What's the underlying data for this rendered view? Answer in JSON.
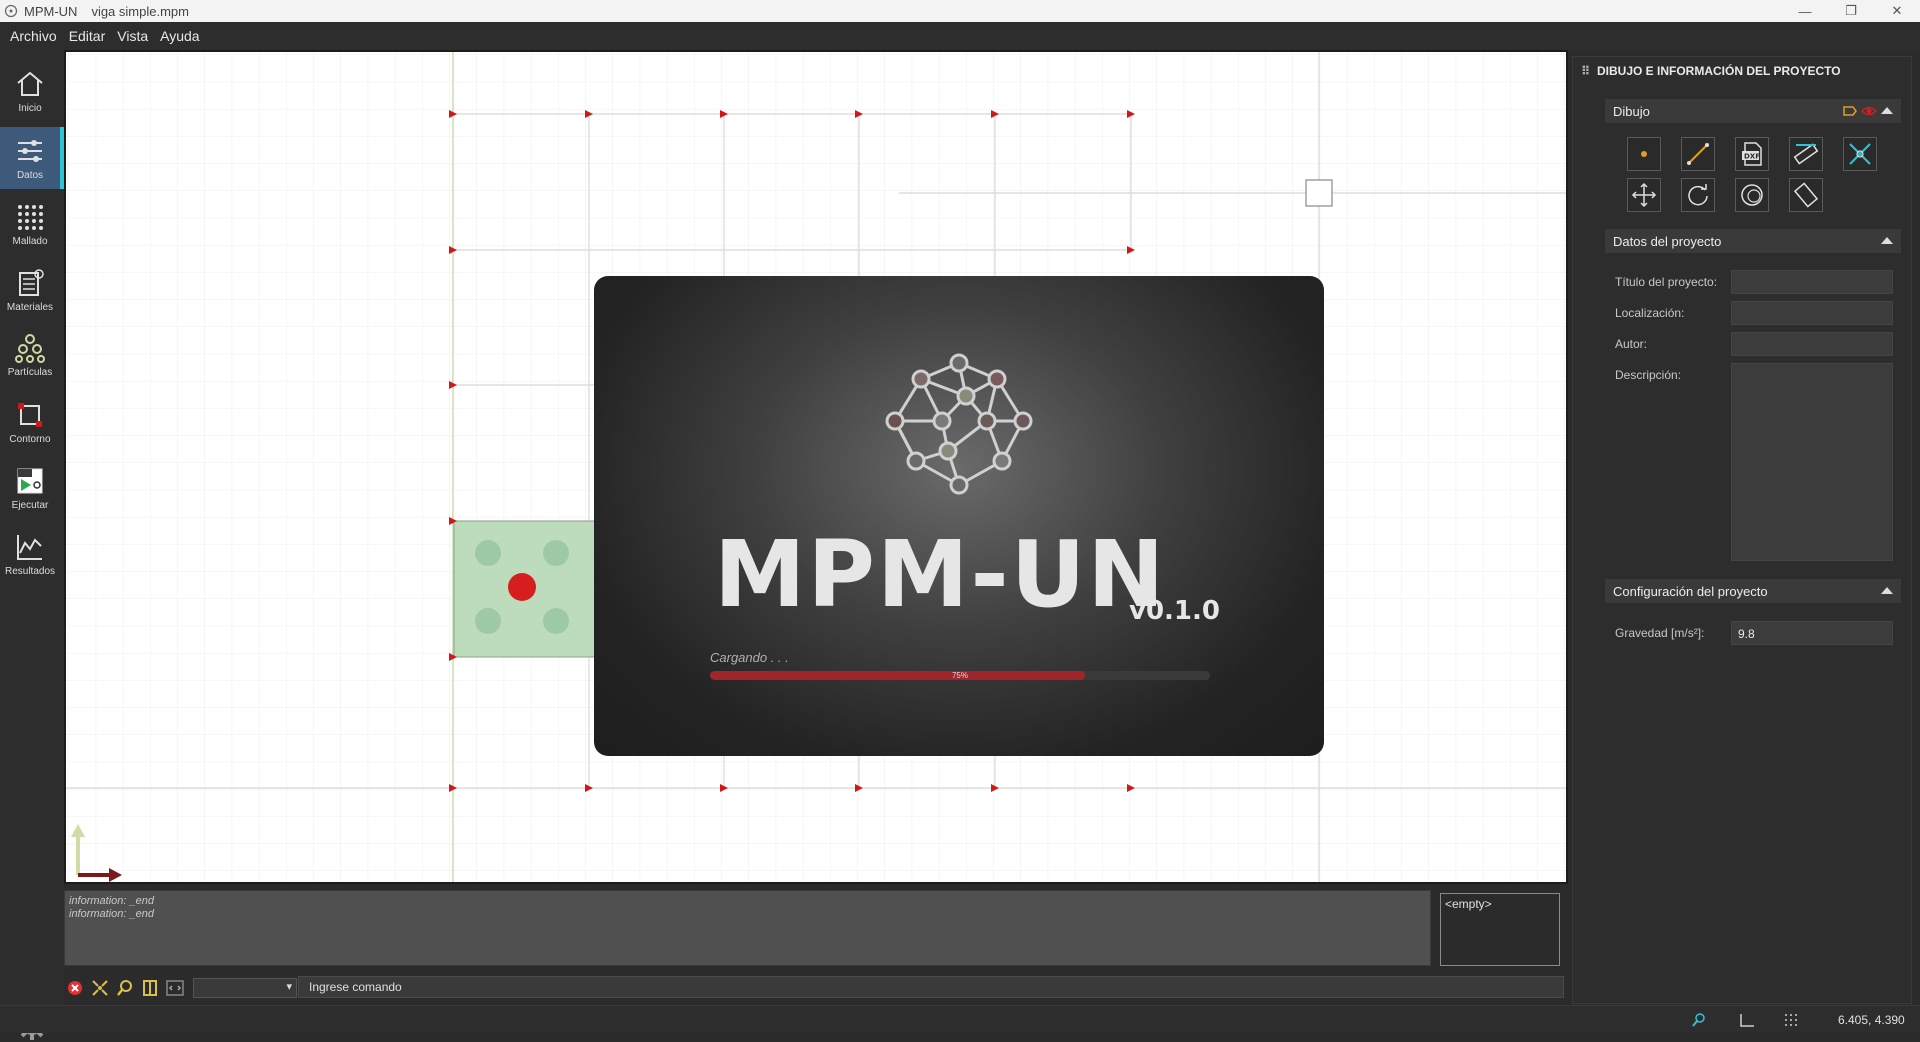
{
  "window": {
    "app_name": "MPM-UN",
    "document": "viga simple.mpm",
    "controls": [
      "—",
      "❐",
      "✕"
    ]
  },
  "menu": [
    "Archivo",
    "Editar",
    "Vista",
    "Ayuda"
  ],
  "left_toolbar": [
    {
      "label": "Inicio",
      "icon": "home-icon"
    },
    {
      "label": "Datos",
      "icon": "sliders-icon",
      "active": true
    },
    {
      "label": "Mallado",
      "icon": "grid-dots-icon"
    },
    {
      "label": "Materiales",
      "icon": "materials-icon"
    },
    {
      "label": "Partículas",
      "icon": "particles-icon"
    },
    {
      "label": "Contorno",
      "icon": "boundary-icon"
    },
    {
      "label": "Ejecutar",
      "icon": "run-icon"
    },
    {
      "label": "Resultados",
      "icon": "results-icon"
    }
  ],
  "splash": {
    "title": "MPM-UN",
    "version": "v0.1.0",
    "loading_text": "Cargando . . .",
    "progress": 0.75,
    "progress_label": "75%"
  },
  "console": {
    "lines": [
      "information: _end",
      "information: _end"
    ],
    "side_list": "<empty>"
  },
  "command": {
    "placeholder": "Ingrese comando",
    "select_value": ""
  },
  "right_panel": {
    "header": "DIBUJO E INFORMACIÓN DEL PROYECTO",
    "sections": {
      "dibujo": "Dibujo",
      "datos": "Datos del proyecto",
      "config": "Configuración del proyecto"
    },
    "draw_tools": [
      "point-icon",
      "line-icon",
      "dxf-icon",
      "ruler-icon",
      "delete-icon",
      "move-icon",
      "rotate-icon",
      "circle-icon",
      "rectangle-icon"
    ],
    "fields": {
      "titulo_label": "Título del proyecto:",
      "localizacion_label": "Localización:",
      "autor_label": "Autor:",
      "descripcion_label": "Descripción:",
      "gravedad_label": "Gravedad [m/s²]:",
      "gravedad_value": "9.8",
      "titulo_value": "",
      "localizacion_value": "",
      "autor_value": "",
      "descripcion_value": ""
    }
  },
  "status": {
    "coords": "6.405, 4.390"
  },
  "colors": {
    "accent": "#2ec4d6",
    "progress": "#a1262c",
    "particle_red": "#d71e1e",
    "particle_green": "#9ec9a6",
    "material_fill": "#bcdcbc",
    "support_marker": "#d01818",
    "axis_x": "#7a1a1a",
    "axis_y": "#cfdca8"
  }
}
